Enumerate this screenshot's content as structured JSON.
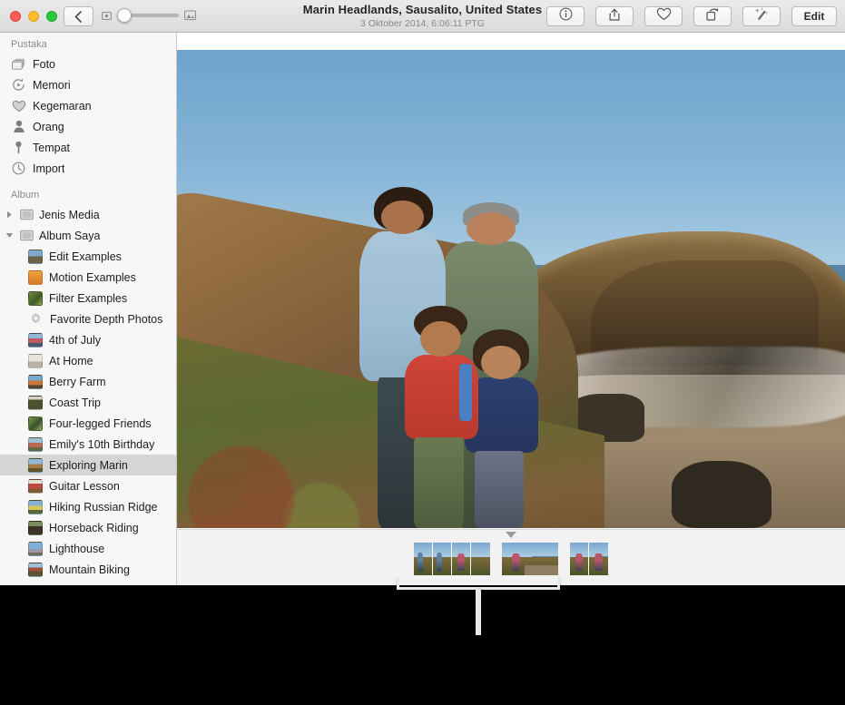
{
  "window": {
    "title": "Marin Headlands, Sausalito, United States",
    "subtitle": "3 Oktober 2014, 6:06:11 PTG"
  },
  "traffic_lights": {
    "close": "close-window",
    "minimize": "minimize-window",
    "maximize": "maximize-window"
  },
  "toolbar": {
    "back_icon": "chevron-left-icon",
    "zoom_small_icon": "small-photo-icon",
    "zoom_large_icon": "large-photo-icon",
    "zoom_value": "0",
    "info_icon": "info-icon",
    "share_icon": "share-icon",
    "favorite_icon": "heart-icon",
    "rotate_icon": "rotate-icon",
    "enhance_icon": "magic-wand-icon",
    "edit_label": "Edit"
  },
  "sidebar": {
    "library_header": "Pustaka",
    "library_items": [
      {
        "label": "Foto",
        "icon": "photos-icon"
      },
      {
        "label": "Memori",
        "icon": "memories-icon"
      },
      {
        "label": "Kegemaran",
        "icon": "heart-icon"
      },
      {
        "label": "Orang",
        "icon": "person-icon"
      },
      {
        "label": "Tempat",
        "icon": "pin-icon"
      },
      {
        "label": "Import",
        "icon": "clock-icon"
      }
    ],
    "album_header": "Album",
    "groups": [
      {
        "label": "Jenis Media",
        "expanded": false,
        "icon": "folder-icon"
      },
      {
        "label": "Album Saya",
        "expanded": true,
        "icon": "folder-icon"
      }
    ],
    "albums": [
      {
        "label": "Edit Examples",
        "selected": false
      },
      {
        "label": "Motion Examples",
        "selected": false
      },
      {
        "label": "Filter Examples",
        "selected": false
      },
      {
        "label": "Favorite Depth Photos",
        "selected": false
      },
      {
        "label": "4th of July",
        "selected": false
      },
      {
        "label": "At Home",
        "selected": false
      },
      {
        "label": "Berry Farm",
        "selected": false
      },
      {
        "label": "Coast Trip",
        "selected": false
      },
      {
        "label": "Four-legged Friends",
        "selected": false
      },
      {
        "label": "Emily's 10th Birthday",
        "selected": false
      },
      {
        "label": "Exploring Marin",
        "selected": true
      },
      {
        "label": "Guitar Lesson",
        "selected": false
      },
      {
        "label": "Hiking Russian Ridge",
        "selected": false
      },
      {
        "label": "Horseback Riding",
        "selected": false
      },
      {
        "label": "Lighthouse",
        "selected": false
      },
      {
        "label": "Mountain Biking",
        "selected": false
      }
    ]
  },
  "main_photo": {
    "description": "Family of four standing on a coastal hillside overlooking a beach and ocean at golden hour"
  },
  "filmstrip": {
    "caret_icon": "caret-down-icon",
    "groups": [
      {
        "thumbs": 4,
        "selected": false
      },
      {
        "thumbs": 1,
        "wide": true,
        "selected": true
      },
      {
        "thumbs": 2,
        "selected": false
      }
    ]
  },
  "annotation": {
    "callout_icon": "callout-bracket"
  },
  "colors": {
    "toolbar_top": "#eaeaea",
    "toolbar_bottom": "#dcdcdc",
    "sidebar_bg": "#f7f7f7",
    "selection": "#d5d5d5",
    "text": "#1d1d1d",
    "muted_text": "#8b8b8b",
    "backdrop": "#000000",
    "callout": "#e9e9e9"
  }
}
